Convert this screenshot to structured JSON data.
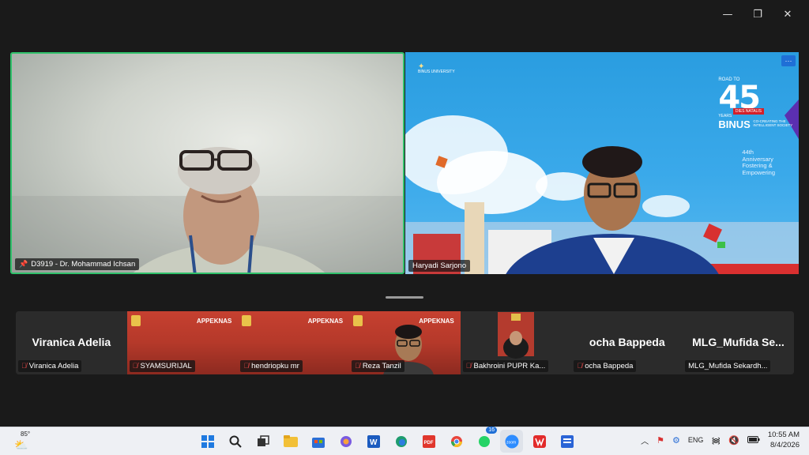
{
  "window": {
    "minimize_glyph": "—",
    "restore_glyph": "❐",
    "close_glyph": "✕"
  },
  "main_tiles": [
    {
      "name": "D3919 - Dr. Mohammad Ichsan",
      "pinned": true
    },
    {
      "name": "Haryadi Sarjono"
    }
  ],
  "slide": {
    "logo_text": "BINUS UNIVERSITY",
    "road_to": "ROAD TO",
    "number": "45",
    "years": "YEARS",
    "brand": "BINUS",
    "dies": "DIES NATALIS",
    "tagline": "CO-CREATING THE INTELLIGENT SOCIETY",
    "anniversary": [
      "44th",
      "Anniversary",
      "Fostering &",
      "Empowering"
    ]
  },
  "more_button": "···",
  "participants": [
    {
      "big": "Viranica Adelia",
      "label": "Viranica Adelia",
      "bg": "dark",
      "muted": true
    },
    {
      "brand": "APPEKNAS",
      "label": "SYAMSURIJAL",
      "bg": "red",
      "muted": true
    },
    {
      "brand": "APPEKNAS",
      "label": "hendriopku mr",
      "bg": "red",
      "muted": true
    },
    {
      "brand": "APPEKNAS",
      "label": "Reza Tanzil",
      "bg": "red",
      "muted": true,
      "video": true
    },
    {
      "label": "Bakhroini PUPR Ka...",
      "bg": "dark",
      "muted": true,
      "thumb": true
    },
    {
      "big": "ocha Bappeda",
      "label": "ocha Bappeda",
      "bg": "dark",
      "muted": true
    },
    {
      "big": "MLG_Mufida  Se...",
      "label": "MLG_Mufida Sekardh...",
      "bg": "dark",
      "muted": false
    }
  ],
  "taskbar": {
    "temperature": "85°",
    "badge_count": "16",
    "zoom_label": "zoom",
    "pdf_label": "PDF",
    "language": "ENG",
    "time": "10:55 AM",
    "date": "8/4/2026"
  }
}
